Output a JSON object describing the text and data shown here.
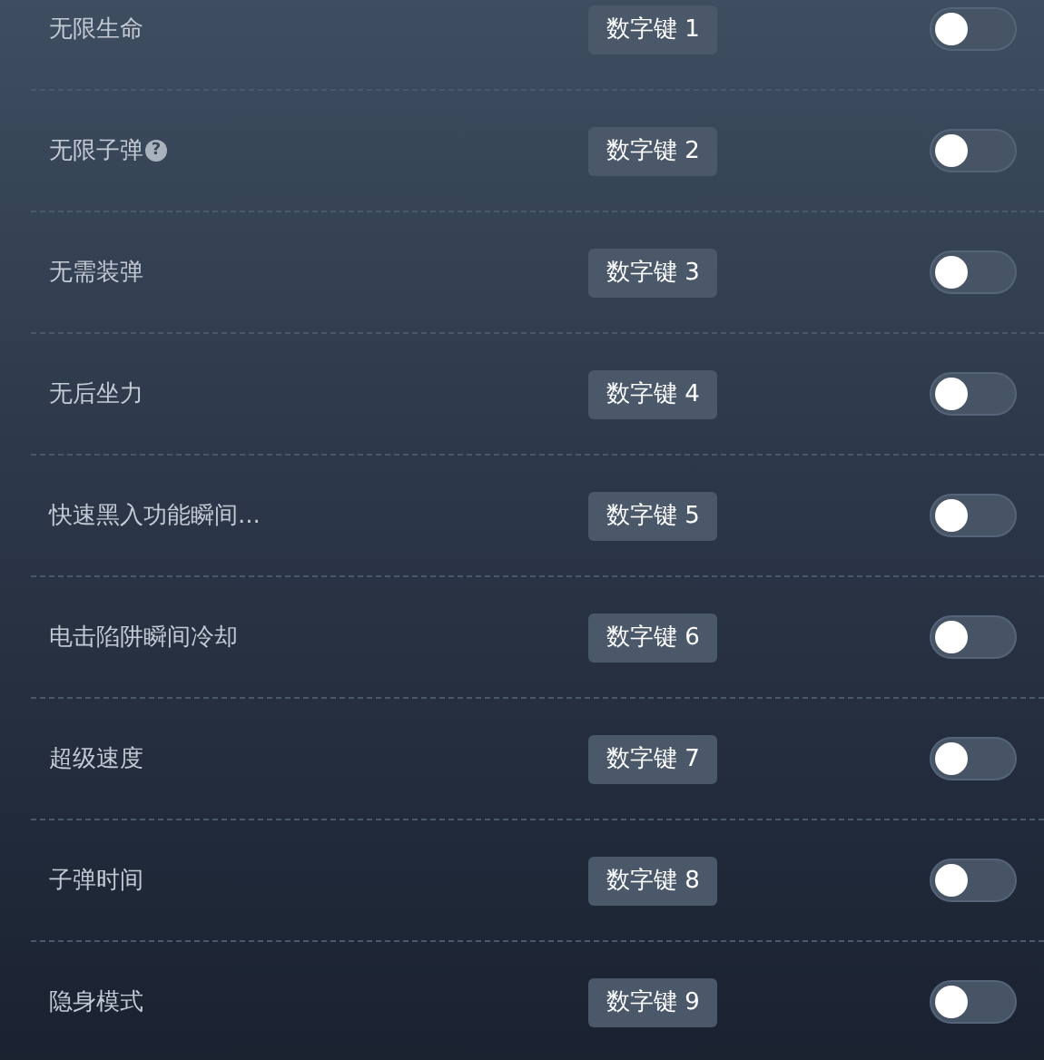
{
  "cheats": [
    {
      "label": "无限生命",
      "hotkey": "数字键 1",
      "on": false
    },
    {
      "label": "无限子弹",
      "help": "?",
      "hotkey": "数字键 2",
      "on": false
    },
    {
      "label": "无需装弹",
      "hotkey": "数字键 3",
      "on": false
    },
    {
      "label": "无后坐力",
      "hotkey": "数字键 4",
      "on": false
    },
    {
      "label": "快速黑入功能瞬间...",
      "hotkey": "数字键 5",
      "on": false
    },
    {
      "label": "电击陷阱瞬间冷却",
      "hotkey": "数字键 6",
      "on": false
    },
    {
      "label": "超级速度",
      "hotkey": "数字键 7",
      "on": false
    },
    {
      "label": "子弹时间",
      "hotkey": "数字键 8",
      "on": false
    },
    {
      "label": "隐身模式",
      "hotkey": "数字键 9",
      "on": false
    }
  ]
}
